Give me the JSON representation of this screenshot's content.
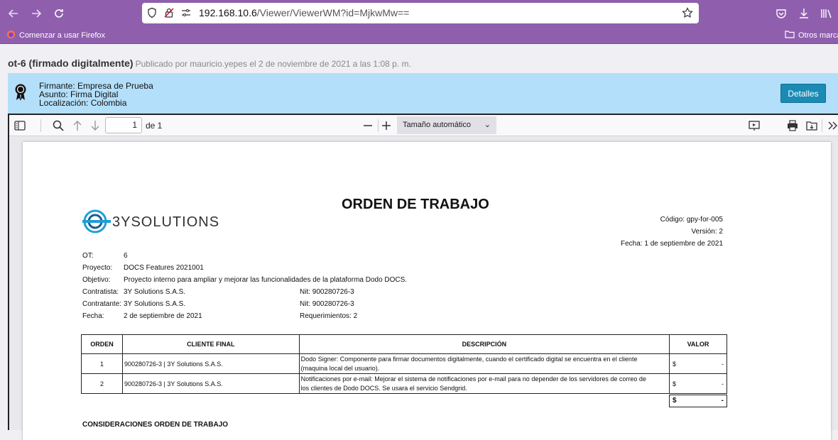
{
  "browser": {
    "url_host": "192.168.10.6",
    "url_path": "/Viewer/ViewerWM?id=MjkwMw==",
    "bookmark_left": "Comenzar a usar Firefox",
    "bookmark_right": "Otros marca"
  },
  "document": {
    "title": "ot-6 (firmado digitalmente)",
    "meta": "Publicado por mauricio.yepes el 2 de noviembre de 2021 a las 1:08 p. m."
  },
  "signature": {
    "line1": "Firmante: Empresa de Prueba",
    "line2": "Asunto: Firma Digital",
    "line3": "Localización: Colombia",
    "button": "Detalles"
  },
  "viewer": {
    "page_number": "1",
    "page_of": "de 1",
    "zoom": "Tamaño automático"
  },
  "pdf": {
    "title": "ORDEN DE TRABAJO",
    "logo_text": "3YSOLUTIONS",
    "codigo": "Código: gpy-for-005",
    "version": "Versión: 2",
    "fecha_doc": "Fecha: 1 de septiembre de 2021",
    "fields": {
      "ot_label": "OT:",
      "ot_value": "6",
      "proyecto_label": "Proyecto:",
      "proyecto_value": "DOCS Features 2021001",
      "objetivo_label": "Objetivo:",
      "objetivo_value": "Proyecto interno para ampliar y mejorar las funcionalidades de la plataforma Dodo DOCS.",
      "contratista_label": "Contratista:",
      "contratista_value": "3Y Solutions S.A.S.",
      "contratista_nit": "Nit: 900280726-3",
      "contratante_label": "Contratante:",
      "contratante_value": "3Y Solutions S.A.S.",
      "contratante_nit": "Nit: 900280726-3",
      "fecha_label": "Fecha:",
      "fecha_value": "2 de septiembre de 2021",
      "requerimientos": "Requerimientos: 2"
    },
    "table": {
      "headers": [
        "ORDEN",
        "CLIENTE FINAL",
        "DESCRIPCIÓN",
        "VALOR"
      ],
      "rows": [
        {
          "orden": "1",
          "cliente": "900280726-3 | 3Y Solutions S.A.S.",
          "descripcion_1": "Dodo Signer: Componente para firmar documentos digitalmente, cuando el certificado digital se encuentra en el cliente",
          "descripcion_2": "(maquina local del usuario).",
          "valor_symbol": "$",
          "valor": "-"
        },
        {
          "orden": "2",
          "cliente": "900280726-3 | 3Y Solutions S.A.S.",
          "descripcion_1": "Notificaciones por e-mail: Mejorar el sistema de notificaciones por e-mail para no depender de los servidores de correo de",
          "descripcion_2": "los clientes de Dodo DOCS. Se usara el servicio Sendgrid.",
          "valor_symbol": "$",
          "valor": "-"
        }
      ],
      "total_symbol": "$",
      "total_value": "-"
    },
    "consideraciones": "CONSIDERACIONES ORDEN DE TRABAJO"
  }
}
